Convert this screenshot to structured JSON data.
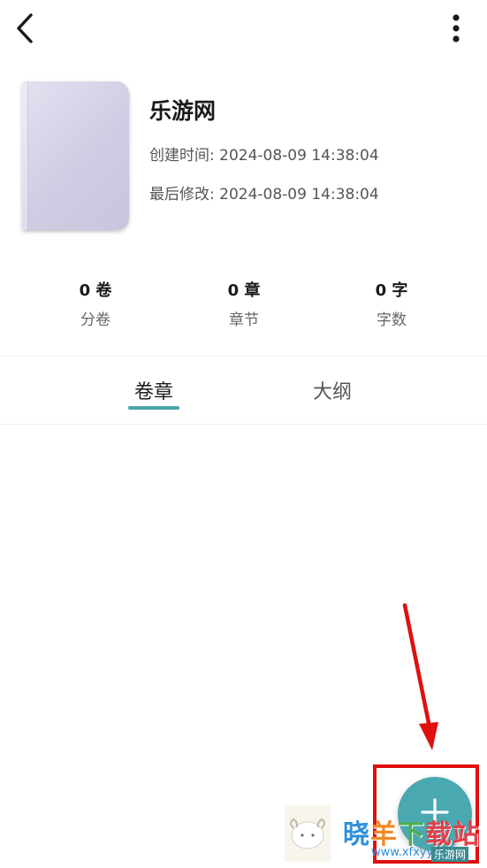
{
  "colors": {
    "accent": "#4aa5ad",
    "fab": "#4aa8b0",
    "annotation": "#e01010",
    "cover": "#cfcde3"
  },
  "header": {
    "back_icon": "chevron-left-icon",
    "more_icon": "more-vertical-icon"
  },
  "book": {
    "title": "乐游网",
    "created": "创建时间: 2024-08-09 14:38:04",
    "modified": "最后修改: 2024-08-09 14:38:04"
  },
  "stats": [
    {
      "value": "0 卷",
      "label": "分卷"
    },
    {
      "value": "0 章",
      "label": "章节"
    },
    {
      "value": "0 字",
      "label": "字数"
    }
  ],
  "tabs": [
    {
      "label": "卷章",
      "active": true
    },
    {
      "label": "大纲",
      "active": false
    }
  ],
  "fab": {
    "icon": "plus-icon"
  },
  "watermark": {
    "chars": [
      "晓",
      "羊",
      "下",
      "载站"
    ],
    "url": "www.xfxyy.com",
    "tag": "乐游网"
  }
}
